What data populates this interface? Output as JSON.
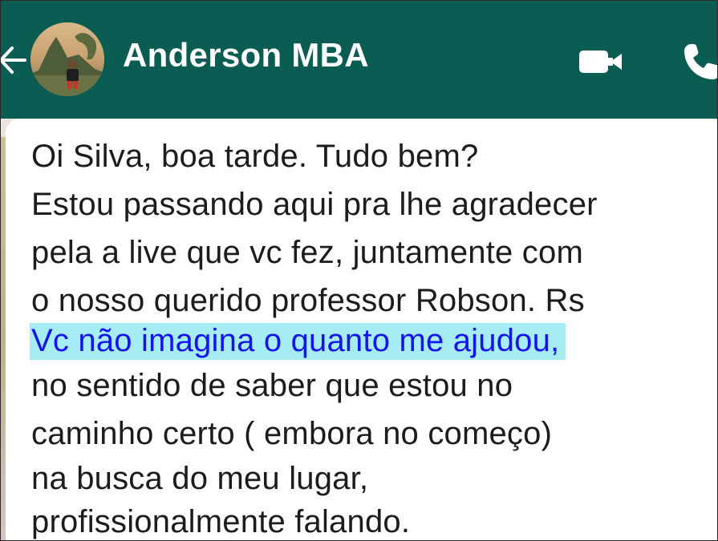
{
  "header": {
    "contact_name": "Anderson MBA",
    "back_icon": "back-arrow-icon",
    "video_icon": "video-camera-icon",
    "phone_icon": "phone-icon",
    "background_color": "#0b5c52"
  },
  "message": {
    "lines": [
      "Oi Silva, boa tarde. Tudo bem?",
      "Estou passando aqui pra lhe agradecer",
      "pela a live que vc fez, juntamente com",
      "o nosso querido professor Robson. Rs",
      "Vc não imagina o quanto me ajudou,",
      "no sentido de saber que estou no",
      "caminho certo ( embora no começo)",
      "na busca do meu lugar,",
      "profissionalmente falando."
    ],
    "highlight_color": "#a6ecf5",
    "highlight_text_color": "#1414ee"
  }
}
